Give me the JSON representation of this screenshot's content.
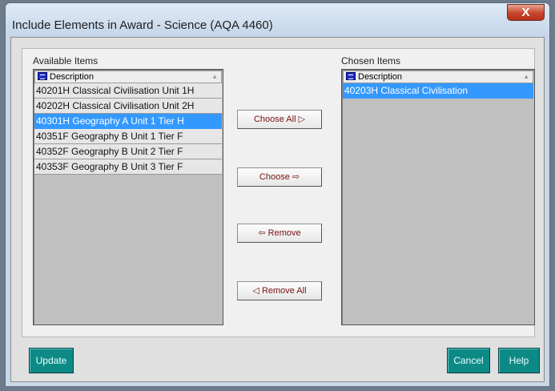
{
  "window": {
    "title": "Include Elements in Award -  Science (AQA 4460)",
    "close_glyph": "X"
  },
  "available": {
    "label": "Available Items",
    "column_header": "Description",
    "items": [
      {
        "text": "40201H Classical Civilisation Unit 1H",
        "selected": false
      },
      {
        "text": "40202H Classical Civilisation Unit 2H",
        "selected": false
      },
      {
        "text": "40301H Geography A Unit 1 Tier H",
        "selected": true
      },
      {
        "text": "40351F Geography B Unit 1 Tier F",
        "selected": false
      },
      {
        "text": "40352F Geography B Unit 2 Tier F",
        "selected": false
      },
      {
        "text": "40353F Geography B Unit 3 Tier F",
        "selected": false
      }
    ]
  },
  "chosen": {
    "label": "Chosen Items",
    "column_header": "Description",
    "items": [
      {
        "text": "40203H Classical Civilisation",
        "selected": true
      }
    ]
  },
  "actions": {
    "choose_all": "Choose All",
    "choose": "Choose",
    "remove": "Remove",
    "remove_all": "Remove All"
  },
  "footer": {
    "update": "Update",
    "cancel": "Cancel",
    "help": "Help"
  },
  "colors": {
    "selection": "#3399ff",
    "footer_button": "#0e8a86",
    "action_text": "#7a1010"
  }
}
